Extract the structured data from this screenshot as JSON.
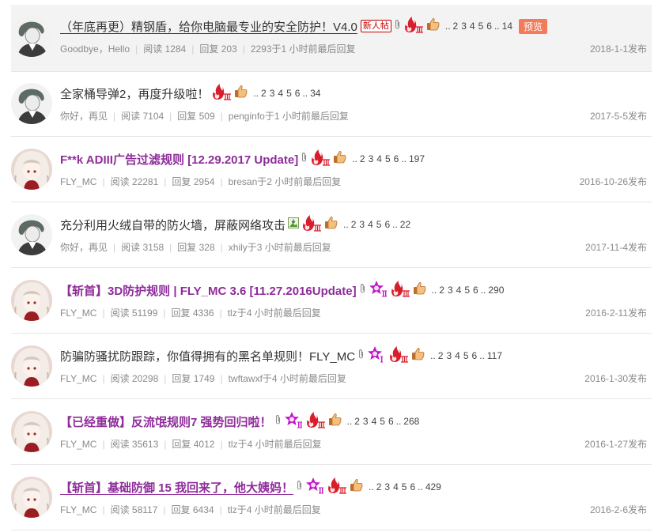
{
  "threads": [
    {
      "title": "（年底再更）精钢盾，给你电脑最专业的安全防护！V4.0",
      "style": "normal-underline",
      "new_badge": "新人帖",
      "icons": [
        "attachment-icon",
        "hot-level-3-icon",
        "thumbs-up-icon"
      ],
      "pages": [
        "2",
        "3",
        "4",
        "5",
        "6"
      ],
      "last_page": "14",
      "preview_label": "预览",
      "author": "Goodbye，Hello",
      "views": "阅读 1284",
      "replies": "回复 203",
      "last_reply": "2293于1 小时前最后回复",
      "date": "2018-1-1发布",
      "avatar": "sketch"
    },
    {
      "title": "全家桶导弹2，再度升级啦！",
      "style": "normal",
      "icons": [
        "hot-level-3-icon",
        "thumbs-up-icon"
      ],
      "pages": [
        "2",
        "3",
        "4",
        "5",
        "6"
      ],
      "last_page": "34",
      "author": "你好，再见",
      "views": "阅读 7104",
      "replies": "回复 509",
      "last_reply": "penginfo于1 小时前最后回复",
      "date": "2017-5-5发布",
      "avatar": "sketch"
    },
    {
      "title": "F**k ADIII广告过滤规则 [12.29.2017 Update]",
      "style": "purple",
      "icons": [
        "attachment-icon",
        "hot-level-3-icon",
        "thumbs-up-icon"
      ],
      "pages": [
        "2",
        "3",
        "4",
        "5",
        "6"
      ],
      "last_page": "197",
      "author": "FLY_MC",
      "views": "阅读 22281",
      "replies": "回复 2954",
      "last_reply": "bresan于2 小时前最后回复",
      "date": "2016-10-26发布",
      "avatar": "anime"
    },
    {
      "title": "充分利用火绒自带的防火墙，屏蔽网络攻击",
      "style": "normal",
      "icons": [
        "image-icon",
        "hot-level-3-icon",
        "thumbs-up-icon"
      ],
      "pages": [
        "2",
        "3",
        "4",
        "5",
        "6"
      ],
      "last_page": "22",
      "author": "你好，再见",
      "views": "阅读 3158",
      "replies": "回复 328",
      "last_reply": "xhily于3 小时前最后回复",
      "date": "2017-11-4发布",
      "avatar": "sketch"
    },
    {
      "title": "【斩首】3D防护规则 | FLY_MC 3.6 [11.27.2016Update]",
      "style": "purple",
      "icons": [
        "attachment-icon",
        "featured-level-2-icon",
        "hot-level-3-icon",
        "thumbs-up-icon"
      ],
      "pages": [
        "2",
        "3",
        "4",
        "5",
        "6"
      ],
      "last_page": "290",
      "author": "FLY_MC",
      "views": "阅读 51199",
      "replies": "回复 4336",
      "last_reply": "tlz于4 小时前最后回复",
      "date": "2016-2-11发布",
      "avatar": "anime"
    },
    {
      "title": "防骗防骚扰防跟踪，你值得拥有的黑名单规则！FLY_MC",
      "style": "normal",
      "icons": [
        "attachment-icon",
        "featured-level-1-icon",
        "hot-level-3-icon",
        "thumbs-up-icon"
      ],
      "pages": [
        "2",
        "3",
        "4",
        "5",
        "6"
      ],
      "last_page": "117",
      "author": "FLY_MC",
      "views": "阅读 20298",
      "replies": "回复 1749",
      "last_reply": "twftawxf于4 小时前最后回复",
      "date": "2016-1-30发布",
      "avatar": "anime"
    },
    {
      "title": "【已经重做】反流氓规则7 强势回归啦！",
      "style": "purple",
      "icons": [
        "attachment-icon",
        "featured-level-2-icon",
        "hot-level-3-icon",
        "thumbs-up-icon"
      ],
      "pages": [
        "2",
        "3",
        "4",
        "5",
        "6"
      ],
      "last_page": "268",
      "author": "FLY_MC",
      "views": "阅读 35613",
      "replies": "回复 4012",
      "last_reply": "tlz于4 小时前最后回复",
      "date": "2016-1-27发布",
      "avatar": "anime"
    },
    {
      "title": "【斩首】基础防御 15 我回来了，他大姨妈！",
      "style": "purple-underline",
      "icons": [
        "attachment-icon",
        "featured-level-2-icon",
        "hot-level-3-icon",
        "thumbs-up-icon"
      ],
      "pages": [
        "2",
        "3",
        "4",
        "5",
        "6"
      ],
      "last_page": "429",
      "author": "FLY_MC",
      "views": "阅读 58117",
      "replies": "回复 6434",
      "last_reply": "tlz于4 小时前最后回复",
      "date": "2016-2-6发布",
      "avatar": "anime"
    }
  ],
  "separator": "|",
  "ellipsis": "..",
  "colors": {
    "purple_title": "#8e2c9a",
    "hot_icon": "#d81e2c",
    "featured_icon": "#c018c8",
    "preview_button": "#f47b5a",
    "meta_text": "#8a8a8a",
    "row_highlight": "#f3f3f3"
  }
}
